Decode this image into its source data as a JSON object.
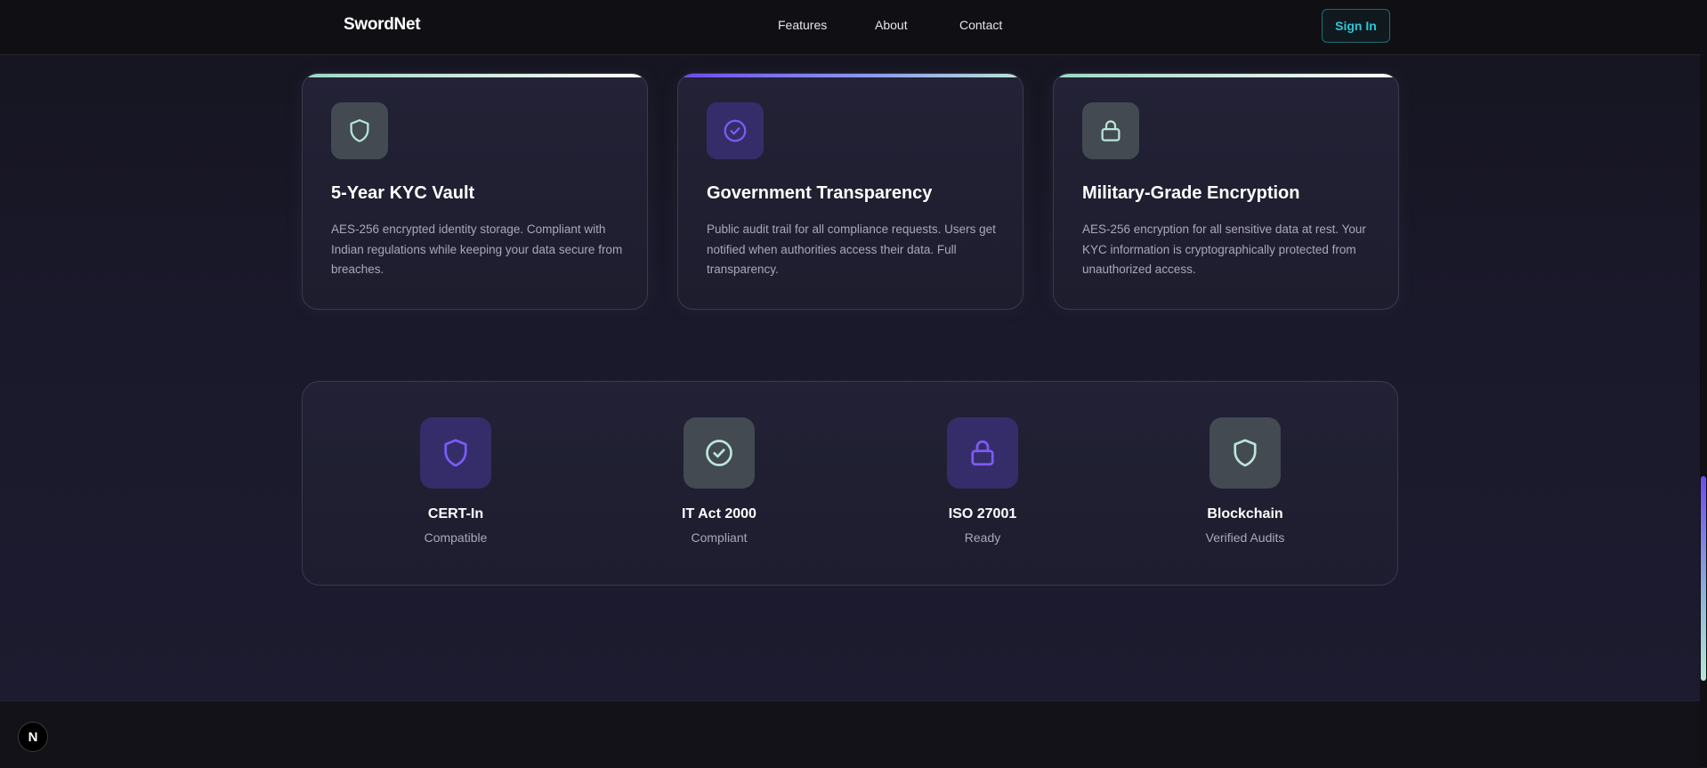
{
  "header": {
    "brand": "SwordNet",
    "nav": [
      "Features",
      "About",
      "Contact"
    ],
    "signin_label": "Sign In"
  },
  "cards": [
    {
      "icon": "shield-icon",
      "title": "5-Year KYC Vault",
      "description": "AES-256 encrypted identity storage. Compliant with Indian regulations while keeping your data secure from breaches."
    },
    {
      "icon": "check-circle-icon",
      "title": "Government Transparency",
      "description": "Public audit trail for all compliance requests. Users get notified when authorities access their data. Full transparency."
    },
    {
      "icon": "lock-icon",
      "title": "Military-Grade Encryption",
      "description": "AES-256 encryption for all sensitive data at rest. Your KYC information is cryptographically protected from unauthorized access."
    }
  ],
  "compliance": [
    {
      "icon": "shield-icon",
      "name": "CERT-In",
      "status": "Compatible"
    },
    {
      "icon": "check-circle-icon",
      "name": "IT Act 2000",
      "status": "Compliant"
    },
    {
      "icon": "lock-icon",
      "name": "ISO 27001",
      "status": "Ready"
    },
    {
      "icon": "shield-icon",
      "name": "Blockchain",
      "status": "Verified Audits"
    }
  ],
  "dev_indicator": {
    "label": "N"
  },
  "colors": {
    "accent_mint": "#b9e6d8",
    "accent_violet": "#7b5cf5",
    "accent_cyan": "#2ec6d8",
    "background": "#181728"
  }
}
